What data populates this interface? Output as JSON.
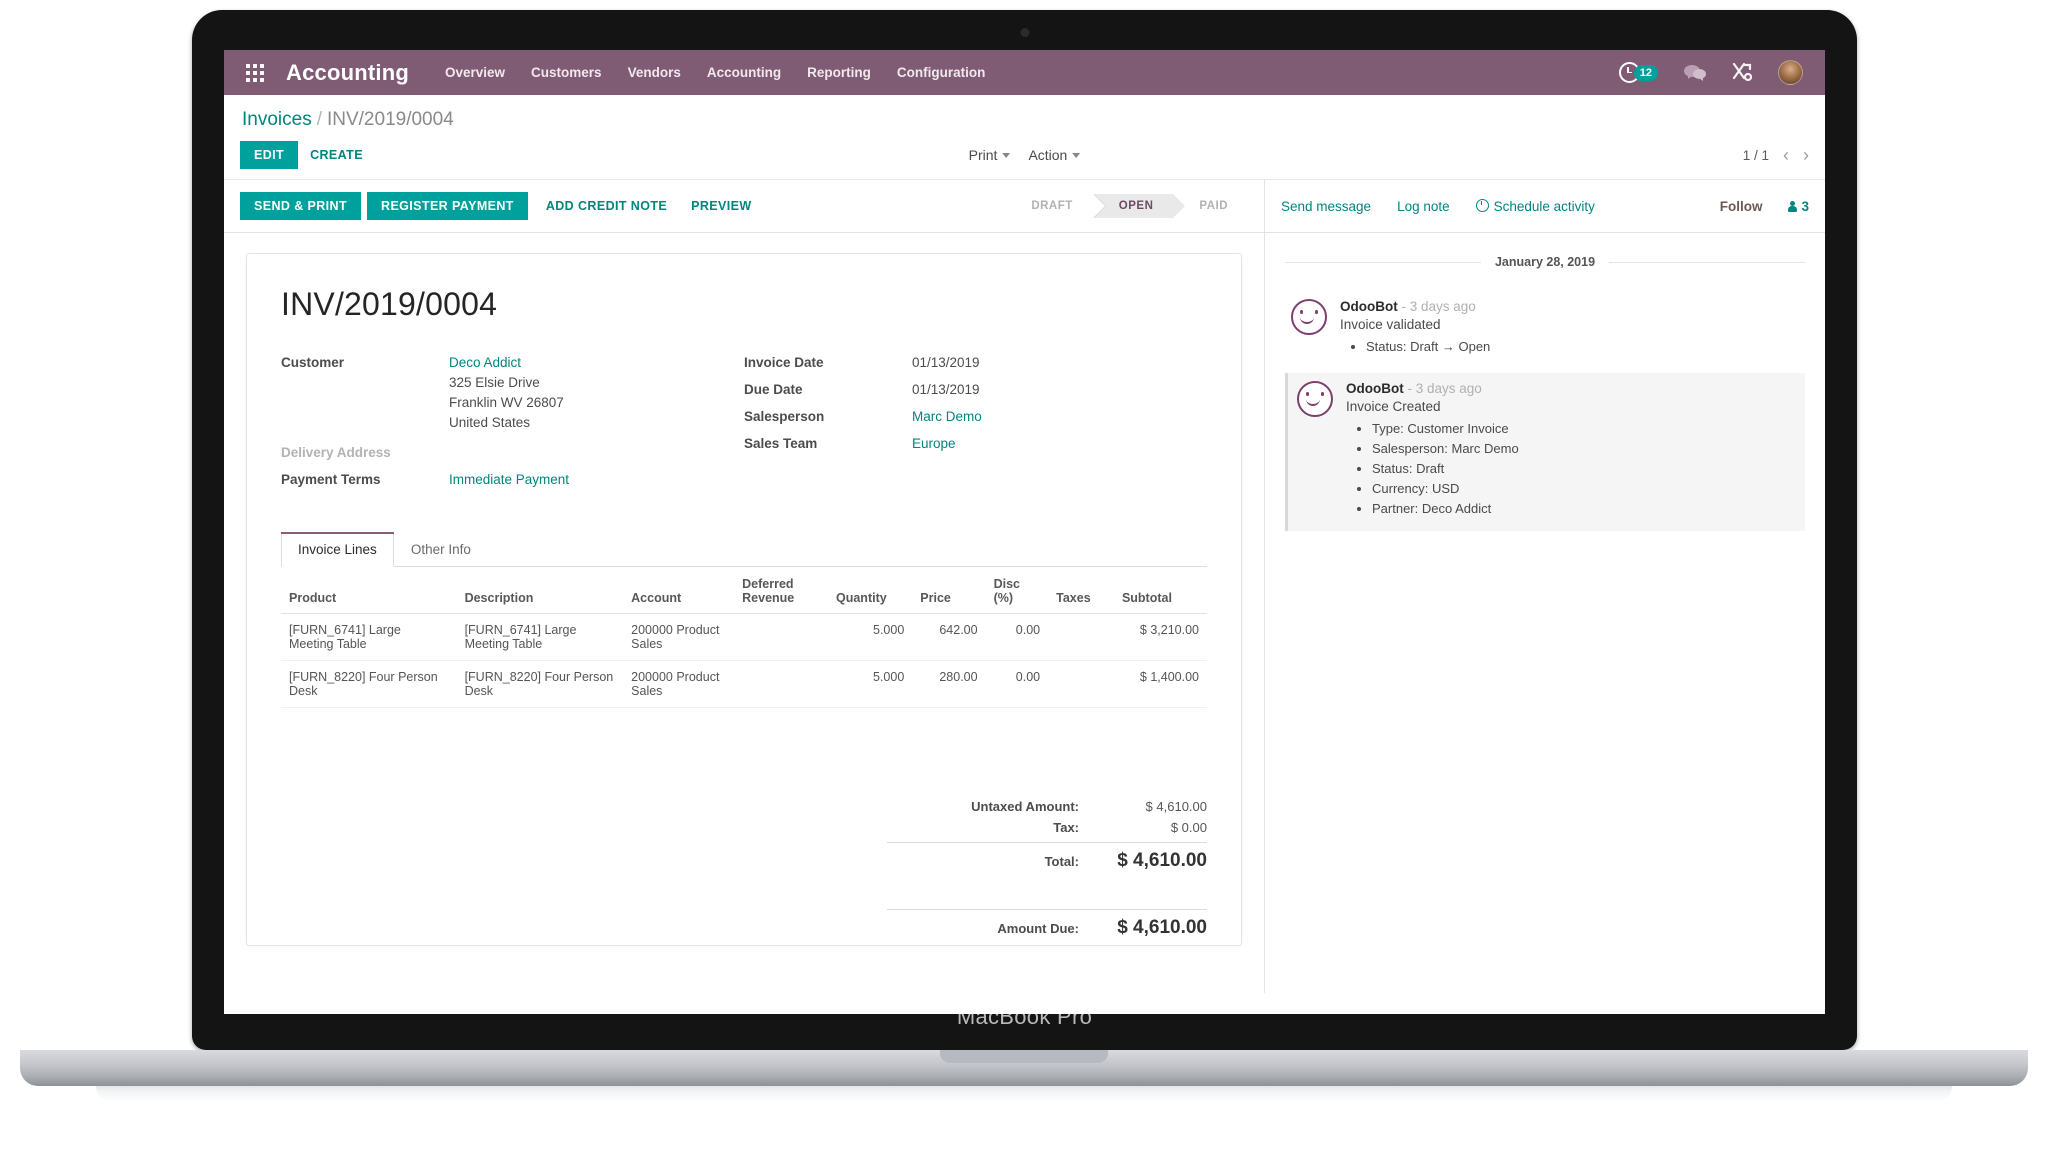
{
  "device": {
    "label": "MacBook Pro"
  },
  "navbar": {
    "apps_icon": "apps-grid-icon",
    "brand": "Accounting",
    "menu": [
      {
        "label": "Overview"
      },
      {
        "label": "Customers"
      },
      {
        "label": "Vendors"
      },
      {
        "label": "Accounting"
      },
      {
        "label": "Reporting"
      },
      {
        "label": "Configuration"
      }
    ],
    "activities_badge": "12",
    "icons": [
      "clock-icon",
      "messaging-icon",
      "tools-icon",
      "user-avatar"
    ]
  },
  "control_panel": {
    "breadcrumb_root": "Invoices",
    "breadcrumb_sep": "/",
    "breadcrumb_current": "INV/2019/0004",
    "edit_label": "EDIT",
    "create_label": "CREATE",
    "print_label": "Print",
    "action_label": "Action",
    "pager": "1 / 1"
  },
  "action_buttons": [
    {
      "label": "SEND & PRINT",
      "style": "primary"
    },
    {
      "label": "REGISTER PAYMENT",
      "style": "primary"
    },
    {
      "label": "ADD CREDIT NOTE",
      "style": "link"
    },
    {
      "label": "PREVIEW",
      "style": "link"
    }
  ],
  "statusbar": [
    {
      "label": "DRAFT",
      "active": false
    },
    {
      "label": "OPEN",
      "active": true
    },
    {
      "label": "PAID",
      "active": false
    }
  ],
  "invoice": {
    "title": "INV/2019/0004",
    "customer_label": "Customer",
    "customer_name": "Deco Addict",
    "customer_street": "325 Elsie Drive",
    "customer_city": "Franklin WV 26807",
    "customer_country": "United States",
    "delivery_address_label": "Delivery Address",
    "payment_terms_label": "Payment Terms",
    "payment_terms_value": "Immediate Payment",
    "invoice_date_label": "Invoice Date",
    "invoice_date_value": "01/13/2019",
    "due_date_label": "Due Date",
    "due_date_value": "01/13/2019",
    "salesperson_label": "Salesperson",
    "salesperson_value": "Marc Demo",
    "sales_team_label": "Sales Team",
    "sales_team_value": "Europe"
  },
  "tabs": [
    {
      "label": "Invoice Lines",
      "active": true
    },
    {
      "label": "Other Info",
      "active": false
    }
  ],
  "lines_table": {
    "columns": [
      "Product",
      "Description",
      "Account",
      "Deferred Revenue",
      "Quantity",
      "Price",
      "Disc (%)",
      "Taxes",
      "Subtotal"
    ],
    "rows": [
      {
        "product": "[FURN_6741] Large Meeting Table",
        "description": "[FURN_6741] Large Meeting Table",
        "account": "200000 Product Sales",
        "deferred_revenue": "",
        "quantity": "5.000",
        "price": "642.00",
        "disc": "0.00",
        "taxes": "",
        "subtotal": "$ 3,210.00"
      },
      {
        "product": "[FURN_8220] Four Person Desk",
        "description": "[FURN_8220] Four Person Desk",
        "account": "200000 Product Sales",
        "deferred_revenue": "",
        "quantity": "5.000",
        "price": "280.00",
        "disc": "0.00",
        "taxes": "",
        "subtotal": "$ 1,400.00"
      }
    ]
  },
  "totals": {
    "untaxed_label": "Untaxed Amount:",
    "untaxed_value": "$ 4,610.00",
    "tax_label": "Tax:",
    "tax_value": "$ 0.00",
    "total_label": "Total:",
    "total_value": "$ 4,610.00",
    "amount_due_label": "Amount Due:",
    "amount_due_value": "$ 4,610.00"
  },
  "chatter": {
    "send_message": "Send message",
    "log_note": "Log note",
    "schedule_activity": "Schedule activity",
    "follow": "Follow",
    "followers_count": "3",
    "date_separator": "January 28, 2019",
    "messages": [
      {
        "author": "OdooBot",
        "time": "- 3 days ago",
        "subject": "Invoice validated",
        "items": [
          "Status: Draft → Open"
        ],
        "highlight": false
      },
      {
        "author": "OdooBot",
        "time": "- 3 days ago",
        "subject": "Invoice Created",
        "items": [
          "Type: Customer Invoice",
          "Salesperson: Marc Demo",
          "Status: Draft",
          "Currency: USD",
          "Partner: Deco Addict"
        ],
        "highlight": true
      }
    ]
  },
  "colors": {
    "navbar": "#7f5b74",
    "primary": "#00a09d",
    "link": "#00857f",
    "status_active_text": "#6d4a63",
    "bot_avatar": "#7f3f6e"
  }
}
